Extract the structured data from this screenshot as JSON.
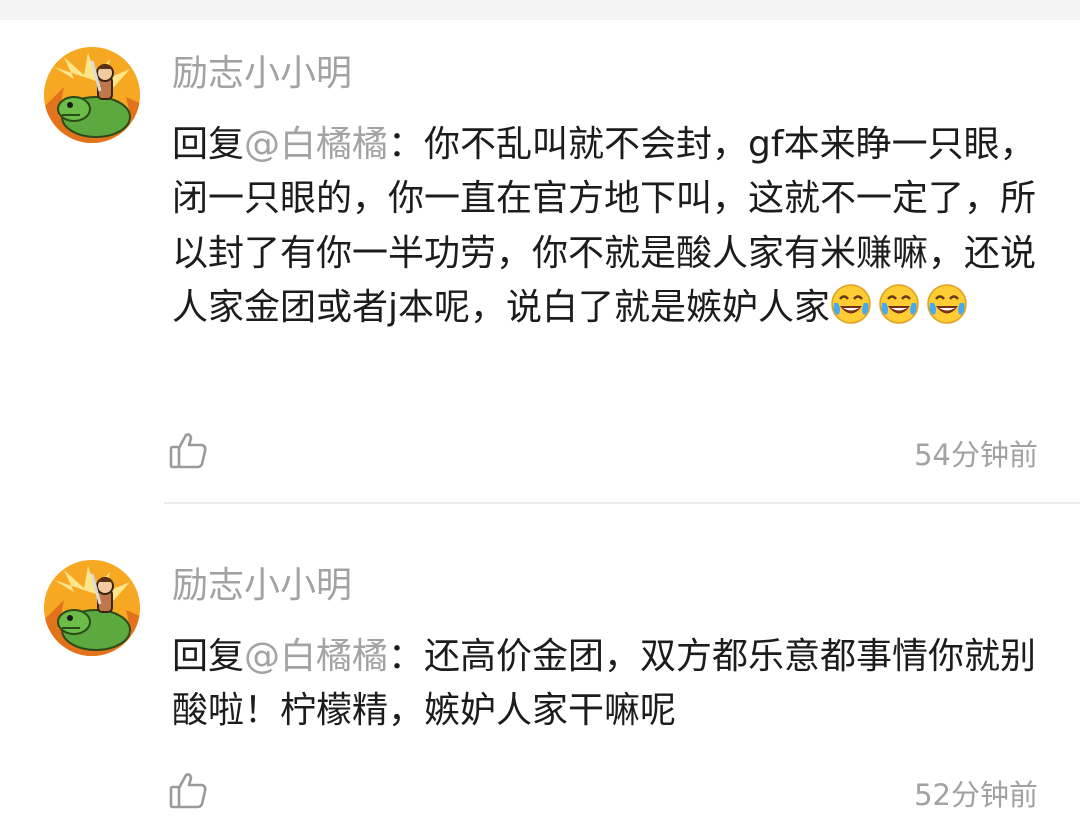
{
  "comments": [
    {
      "username": "励志小小明",
      "reply_prefix": "回复",
      "mention": "@白橘橘",
      "colon": "：",
      "text": "你不乱叫就不会封，gf本来睁一只眼，闭一只眼的，你一直在官方地下叫，这就不一定了，所以封了有你一半功劳，你不就是酸人家有米赚嘛，还说人家金团或者j本呢，说白了就是嫉妒人家",
      "emojis": [
        "tears-of-joy-emoji",
        "tears-of-joy-emoji",
        "tears-of-joy-emoji"
      ],
      "time": "54分钟前"
    },
    {
      "username": "励志小小明",
      "reply_prefix": "回复",
      "mention": "@白橘橘",
      "colon": "：",
      "text": "还高价金团，双方都乐意都事情你就别酸啦！柠檬精，嫉妒人家干嘛呢",
      "emojis": [],
      "time": "52分钟前"
    }
  ],
  "icons": {
    "like": "thumbs-up-icon"
  },
  "colors": {
    "username": "#a2a2a2",
    "text": "#1c1c1c",
    "mention": "#a3a3a3",
    "avatar_bg": "#f6a823"
  }
}
